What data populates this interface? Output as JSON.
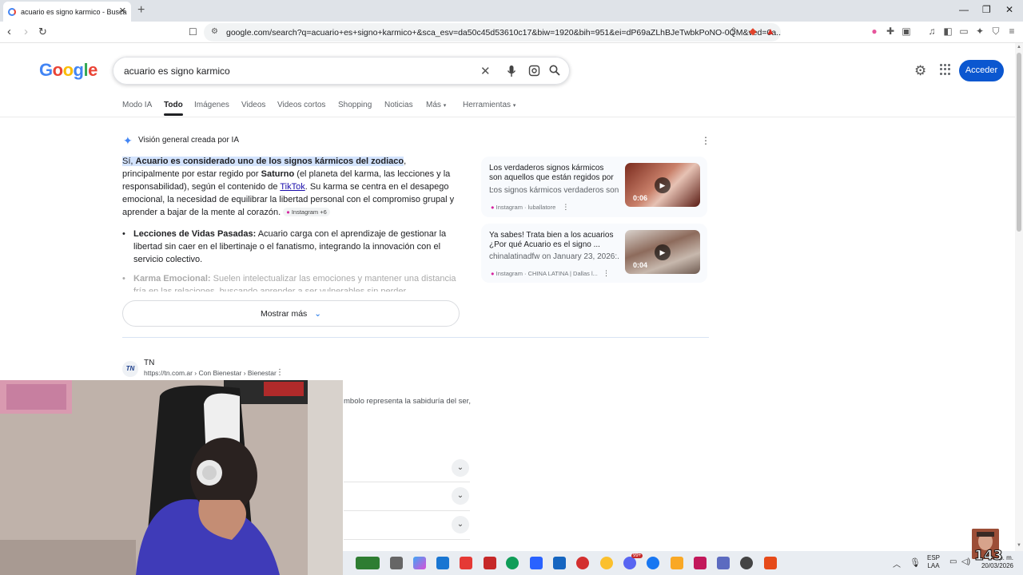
{
  "browser": {
    "tab_title": "acuario es signo karmico - Busca",
    "url": "google.com/search?q=acuario+es+signo+karmico+&sca_esv=da50c45d53610c17&biw=1920&bih=951&ei=dP69aZLhBJeTwbkPoNO-0QM&ved=0a..."
  },
  "google": {
    "logo": "Google",
    "query": "acuario es signo karmico",
    "signin_label": "Acceder",
    "tabs": [
      "Modo IA",
      "Todo",
      "Imágenes",
      "Videos",
      "Videos cortos",
      "Shopping",
      "Noticias",
      "Más",
      "Herramientas"
    ],
    "active_tab": "Todo"
  },
  "ai_overview": {
    "label": "Visión general creada por IA",
    "p_si": "Sí, ",
    "p_highlight": "Acuario es considerado uno de los signos kármicos del zodiaco",
    "p_a": ", principalmente por estar regido por ",
    "p_saturno": "Saturno",
    "p_b": " (el planeta del karma, las lecciones y la responsabilidad), según el contenido de ",
    "p_link": "TikTok",
    "p_c": ". Su karma se centra en el desapego emocional, la necesidad de equilibrar la libertad personal con el compromiso grupal y aprender a bajar de la mente al corazón.",
    "p_chip": "Instagram +6",
    "b1_title": "Lecciones de Vidas Pasadas:",
    "b1_text": " Acuario carga con el aprendizaje de gestionar la libertad sin caer en el libertinaje o el fanatismo, integrando la innovación con el servicio colectivo.",
    "b2_title": "Karma Emocional:",
    "b2_text": " Suelen intelectualizar las emociones y mantener una distancia fría en las relaciones, buscando aprender a ser vulnerables sin perder",
    "show_more": "Mostrar más",
    "videos": [
      {
        "title": "Los verdaderos signos kármicos son aquellos que están regidos por ...",
        "subtitle": "Los signos kármicos verdaderos son...",
        "source": "Instagram · luballatore",
        "duration": "0:06"
      },
      {
        "title": "Ya sabes! Trata bien a los acuarios ¿Por qué Acuario es el signo ...",
        "subtitle": "chinalatinadfw on January 23, 2026:...",
        "source": "Instagram · CHINA LATINA | Dallas l...",
        "duration": "0:04"
      }
    ]
  },
  "result": {
    "site_name": "TN",
    "site_url": "https://tn.com.ar › Con Bienestar › Bienestar",
    "logo_text": "TN",
    "snippet": "mbolo representa la sabiduría del ser,"
  },
  "taskbar": {
    "lang_1": "ESP",
    "lang_2": "LAA",
    "time": "...3 p. m.",
    "date": "20/03/2026",
    "badge": "99+"
  },
  "overlay": {
    "corner_text": "143"
  }
}
